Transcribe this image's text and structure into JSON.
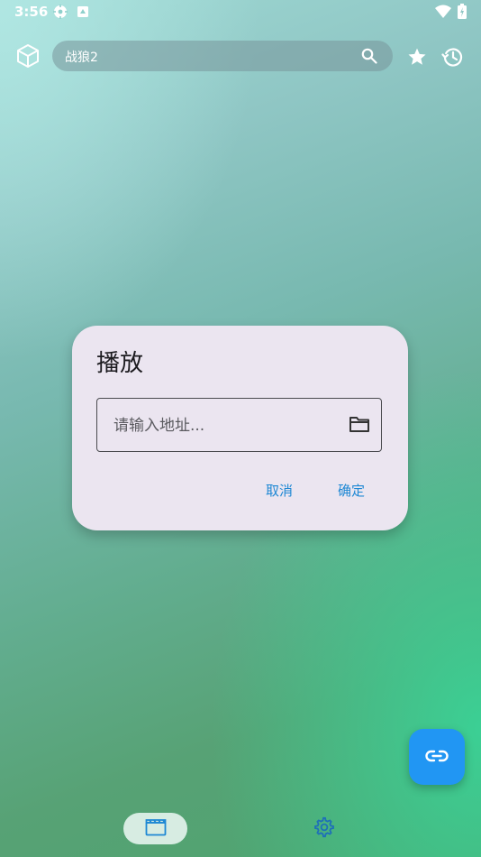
{
  "status_bar": {
    "time": "3:56",
    "icons": [
      "location-gear-icon",
      "notification-box-icon",
      "wifi-icon",
      "battery-icon"
    ]
  },
  "top_bar": {
    "app_icon": "cube-icon",
    "search": {
      "text": "战狼2",
      "icon": "search-icon"
    },
    "actions": [
      "star-icon",
      "history-icon"
    ]
  },
  "dialog": {
    "title": "播放",
    "input_placeholder": "请输入地址...",
    "input_value": "",
    "folder_icon": "folder-icon",
    "cancel_label": "取消",
    "confirm_label": "确定"
  },
  "fab": {
    "icon": "link-icon"
  },
  "bottom_nav": [
    {
      "icon": "clapperboard-icon",
      "selected": true
    },
    {
      "icon": "gear-icon",
      "selected": false
    }
  ],
  "colors": {
    "accent": "#1e88d4",
    "fab": "#2196f3",
    "dialog_bg": "#ebe5f0",
    "nav_selected_bg": "#d7ece2"
  }
}
